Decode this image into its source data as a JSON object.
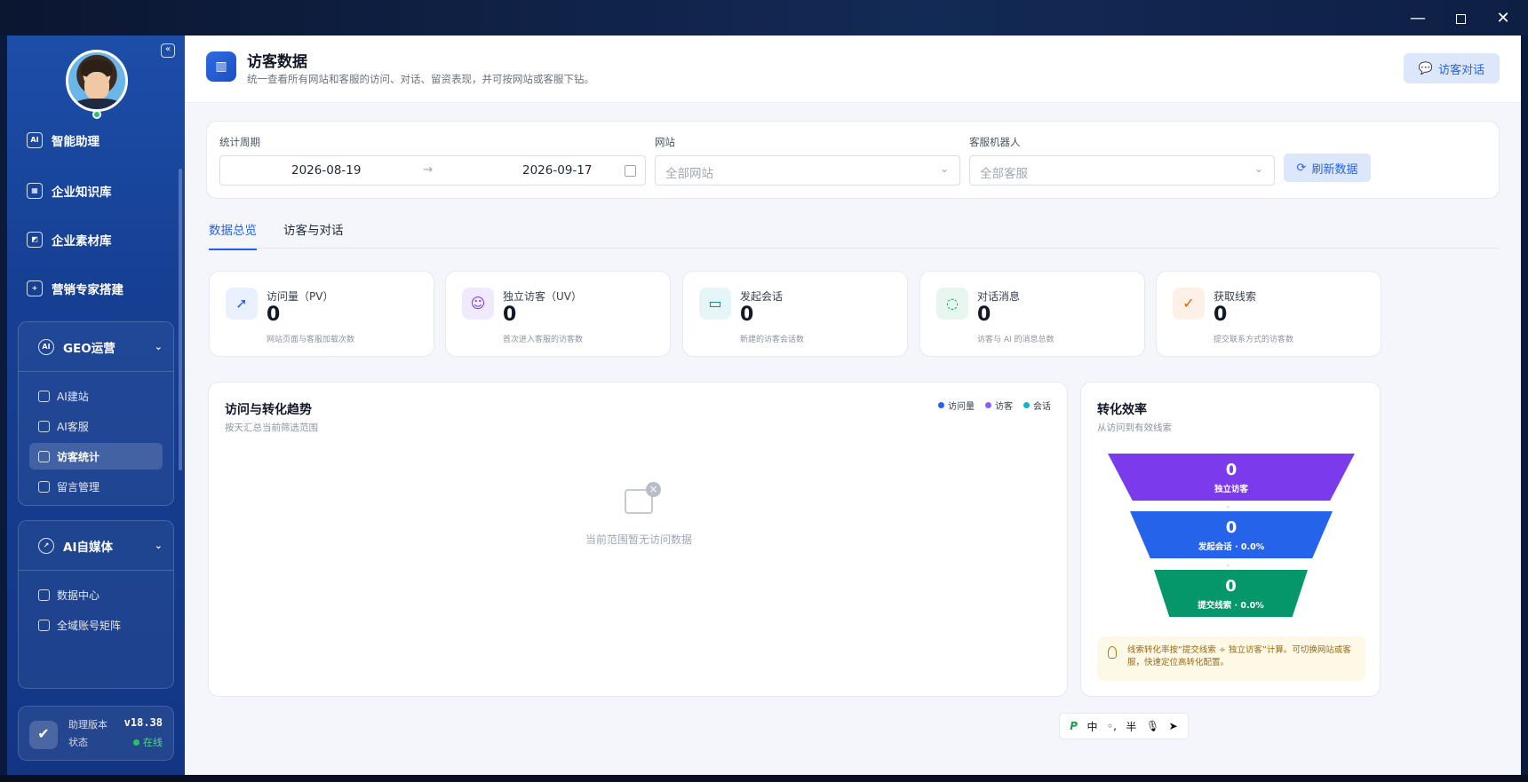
{
  "window": {
    "minimize": "—",
    "close": "✕"
  },
  "sidebar": {
    "nav": [
      {
        "label": "智能助理",
        "icon": "ai-chat-icon",
        "glyph": "AI"
      },
      {
        "label": "企业知识库",
        "icon": "building-icon",
        "glyph": "▦"
      },
      {
        "label": "企业素材库",
        "icon": "image-icon",
        "glyph": "◩"
      },
      {
        "label": "营销专家搭建",
        "icon": "user-plus-icon",
        "glyph": "+"
      }
    ],
    "geo_group": {
      "label": "GEO运营",
      "glyph": "AI",
      "items": [
        {
          "label": "AI建站",
          "icon": "robot-icon"
        },
        {
          "label": "AI客服",
          "icon": "phone-chat-icon"
        },
        {
          "label": "访客统计",
          "icon": "stats-icon",
          "active": true
        },
        {
          "label": "留言管理",
          "icon": "message-box-icon"
        }
      ]
    },
    "media_group": {
      "label": "AI自媒体",
      "glyph": "↗",
      "items": [
        {
          "label": "数据中心",
          "icon": "target-icon"
        },
        {
          "label": "全域账号矩阵",
          "icon": "file-icon"
        }
      ]
    },
    "version": {
      "label": "助理版本",
      "value": "v18.38",
      "status_label": "状态",
      "status_value": "在线"
    }
  },
  "header": {
    "title": "访客数据",
    "subtitle": "统一查看所有网站和客服的访问、对话、留资表现，并可按网站或客服下钻。",
    "chat_button": "访客对话"
  },
  "filters": {
    "period_label": "统计周期",
    "start_date": "2026-08-19",
    "end_date": "2026-09-17",
    "site_label": "网站",
    "site_placeholder": "全部网站",
    "bot_label": "客服机器人",
    "bot_placeholder": "全部客服",
    "refresh_button": "刷新数据"
  },
  "tabs": [
    {
      "label": "数据总览",
      "active": true
    },
    {
      "label": "访客与对话",
      "active": false
    }
  ],
  "stats": [
    {
      "label": "访问量（PV）",
      "value": "0",
      "desc": "网站页面与客服加载次数",
      "icon": "cursor-click-icon",
      "color": "#2563eb",
      "bg": "#eaf1fe"
    },
    {
      "label": "独立访客（UV）",
      "value": "0",
      "desc": "首次进入客服的访客数",
      "icon": "users-icon",
      "color": "#7c3aed",
      "bg": "#f1eafe"
    },
    {
      "label": "发起会话",
      "value": "0",
      "desc": "新建的访客会话数",
      "icon": "chat-bubbles-icon",
      "color": "#0e7490",
      "bg": "#e6f6f8"
    },
    {
      "label": "对话消息",
      "value": "0",
      "desc": "访客与 AI 的消息总数",
      "icon": "message-dots-icon",
      "color": "#059669",
      "bg": "#e7f7f0"
    },
    {
      "label": "获取线索",
      "value": "0",
      "desc": "提交联系方式的访客数",
      "icon": "user-check-icon",
      "color": "#ea580c",
      "bg": "#fdf0e7"
    }
  ],
  "trend": {
    "title": "访问与转化趋势",
    "subtitle": "按天汇总当前筛选范围",
    "legend": [
      {
        "label": "访问量",
        "color": "#2563eb"
      },
      {
        "label": "访客",
        "color": "#8b5cf6"
      },
      {
        "label": "会话",
        "color": "#06b6d4"
      }
    ],
    "empty_text": "当前范围暂无访问数据"
  },
  "funnel": {
    "title": "转化效率",
    "subtitle": "从访问到有效线索",
    "steps": [
      {
        "value": "0",
        "label": "独立访客"
      },
      {
        "value": "0",
        "label": "发起会话 · 0.0%"
      },
      {
        "value": "0",
        "label": "提交线索 · 0.0%"
      }
    ],
    "tip": "线索转化率按“提交线索 ÷ 独立访客”计算。可切换网站或客服，快速定位高转化配置。"
  },
  "ime": {
    "lang": "中",
    "punct": "◦,",
    "width": "半"
  }
}
